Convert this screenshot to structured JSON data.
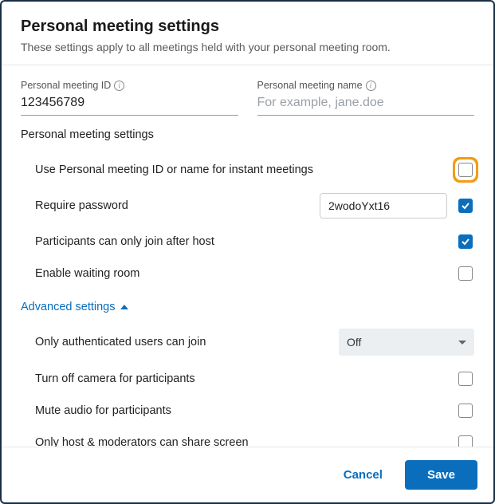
{
  "header": {
    "title": "Personal meeting settings",
    "subtitle": "These settings apply to all meetings held with your personal meeting room."
  },
  "fields": {
    "id_label": "Personal meeting ID",
    "id_value": "123456789",
    "name_label": "Personal meeting name",
    "name_placeholder": "For example, jane.doe",
    "name_value": ""
  },
  "section_label": "Personal meeting settings",
  "settings": {
    "use_pm_id": {
      "label": "Use Personal meeting ID or name for instant meetings",
      "checked": false,
      "highlighted": true
    },
    "require_password": {
      "label": "Require password",
      "value": "2wodoYxt16",
      "checked": true
    },
    "join_after_host": {
      "label": "Participants can only join after host",
      "checked": true
    },
    "waiting_room": {
      "label": "Enable waiting room",
      "checked": false
    }
  },
  "advanced": {
    "toggle_label": "Advanced settings",
    "expanded": true,
    "auth_users": {
      "label": "Only authenticated users can join",
      "select_value": "Off"
    },
    "turn_off_camera": {
      "label": "Turn off camera for participants",
      "checked": false
    },
    "mute_audio": {
      "label": "Mute audio for participants",
      "checked": false
    },
    "host_share": {
      "label": "Only host & moderators can share screen",
      "checked": false
    }
  },
  "footer": {
    "cancel": "Cancel",
    "save": "Save"
  }
}
